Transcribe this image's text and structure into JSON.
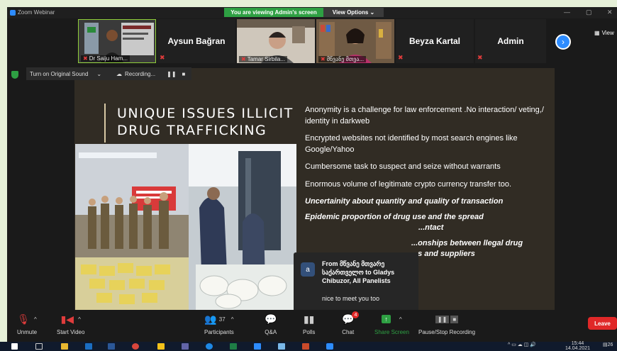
{
  "window": {
    "title": "Zoom Webinar",
    "viewing_banner": "You are viewing Admin's screen",
    "view_options": "View Options"
  },
  "participants_strip": {
    "tiles": [
      {
        "name": "Dr Saiju Ham...",
        "kind": "video"
      },
      {
        "name": "Aysun Bağran",
        "kind": "name"
      },
      {
        "name": "Tamar Sirbila...",
        "kind": "video"
      },
      {
        "name": "მწვანე მთვა...",
        "kind": "video"
      },
      {
        "name": "Beyza Kartal",
        "kind": "name"
      },
      {
        "name": "Admin",
        "kind": "name"
      }
    ],
    "view_label": "View"
  },
  "controls_row": {
    "original_sound": "Turn on Original Sound",
    "recording": "Recording..."
  },
  "slide": {
    "title_line1": "UNIQUE ISSUES ILLICIT",
    "title_line2": "DRUG TRAFFICKING",
    "bullets": [
      "Anonymity is a  challenge for law enforcement .No interaction/ veting,/ identity in darkweb",
      "Encrypted websites not identified by most search engines like Google/Yahoo",
      "Cumbersome task to suspect and seize without warrants",
      "Enormous volume of legitimate crypto currency transfer too."
    ],
    "emphasis": [
      "Uncertainity about quantity and quality of transaction",
      "Epidemic proportion of drug use and the spread",
      "...ntact",
      "...onships between llegal drug",
      "...s and suppliers"
    ]
  },
  "chat_popup": {
    "avatar": "a",
    "from": "From მწვანე მთვარე საქართველო to Gladys Chibuzor, All Panelists",
    "message": "nice to meet you too"
  },
  "toolbar": {
    "unmute": "Unmute",
    "start_video": "Start Video",
    "participants": "Participants",
    "participants_count": "37",
    "qa": "Q&A",
    "polls": "Polls",
    "chat": "Chat",
    "chat_badge": "4",
    "share_screen": "Share Screen",
    "pause_recording": "Pause/Stop Recording",
    "leave": "Leave"
  },
  "taskbar": {
    "time": "15:44",
    "date": "14.04.2021",
    "notif": "26"
  }
}
